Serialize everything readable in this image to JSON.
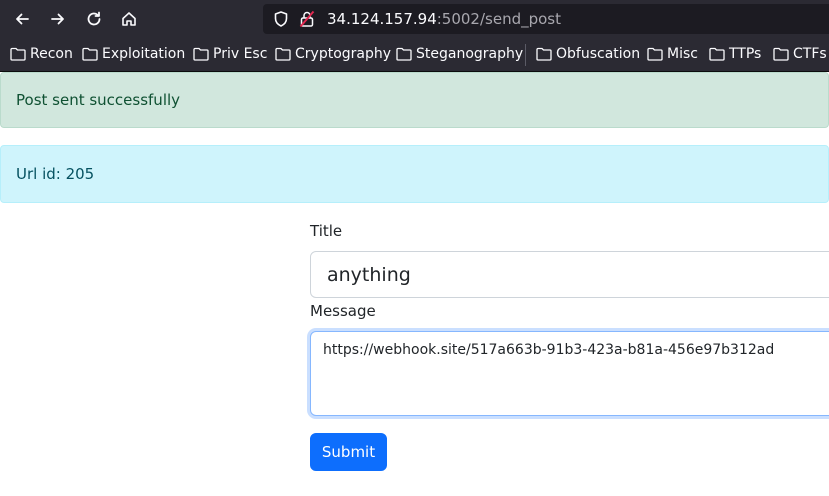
{
  "browser": {
    "url_host": "34.124.157.94",
    "url_rest": ":5002/send_post",
    "bookmarks": [
      "Recon",
      "Exploitation",
      "Priv Esc",
      "Cryptography",
      "Steganography",
      "Obfuscation",
      "Misc",
      "TTPs",
      "CTFs"
    ]
  },
  "alerts": {
    "success": "Post sent successfully",
    "info": "Url id: 205"
  },
  "form": {
    "title_label": "Title",
    "title_value": "anything",
    "message_label": "Message",
    "message_value": "https://webhook.site/517a663b-91b3-423a-b81a-456e97b312ad",
    "submit_label": "Submit"
  },
  "colors": {
    "toolbar_bg": "#2b2a33",
    "success_bg": "#d1e7dd",
    "info_bg": "#cff4fc",
    "primary": "#0d6efd"
  }
}
